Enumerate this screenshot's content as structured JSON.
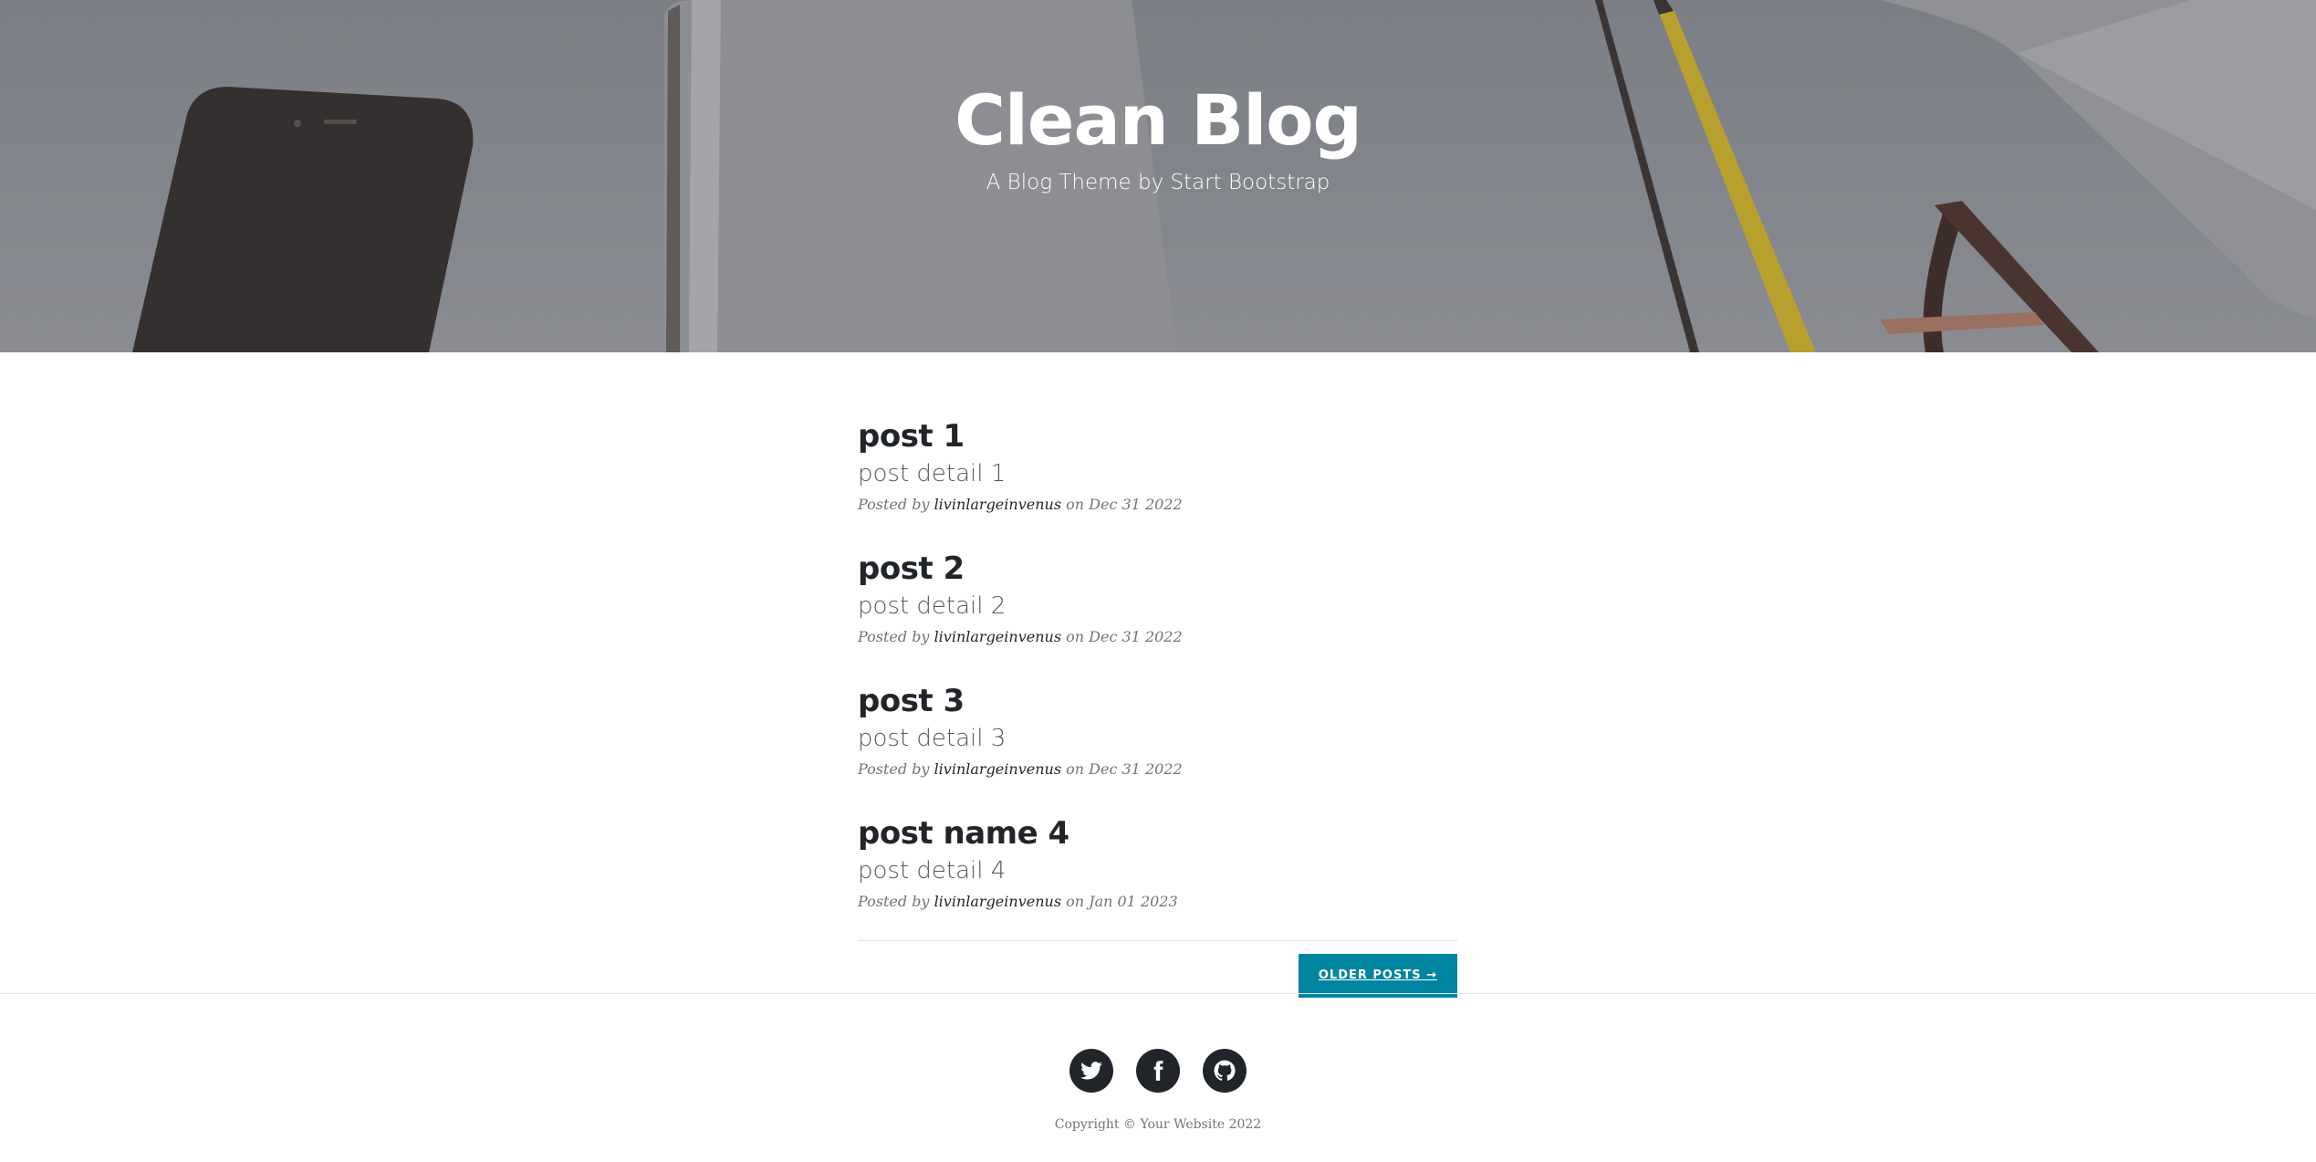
{
  "header": {
    "title": "Clean Blog",
    "subtitle": "A Blog Theme by Start Bootstrap"
  },
  "posts": [
    {
      "title": "post 1",
      "detail": "post detail 1",
      "posted_by_label": "Posted by",
      "author": "livinlargeinvenus",
      "on_label": "on",
      "date": "Dec 31 2022"
    },
    {
      "title": "post 2",
      "detail": "post detail 2",
      "posted_by_label": "Posted by",
      "author": "livinlargeinvenus",
      "on_label": "on",
      "date": "Dec 31 2022"
    },
    {
      "title": "post 3",
      "detail": "post detail 3",
      "posted_by_label": "Posted by",
      "author": "livinlargeinvenus",
      "on_label": "on",
      "date": "Dec 31 2022"
    },
    {
      "title": "post name 4",
      "detail": "post detail 4",
      "posted_by_label": "Posted by",
      "author": "livinlargeinvenus",
      "on_label": "on",
      "date": "Jan 01 2023"
    }
  ],
  "pager": {
    "older_label": "Older Posts →"
  },
  "footer": {
    "social": [
      "twitter-icon",
      "facebook-icon",
      "github-icon"
    ],
    "copyright": "Copyright © Your Website 2022"
  },
  "colors": {
    "accent": "#0085a1",
    "text": "#212529",
    "muted": "#6c757d"
  }
}
